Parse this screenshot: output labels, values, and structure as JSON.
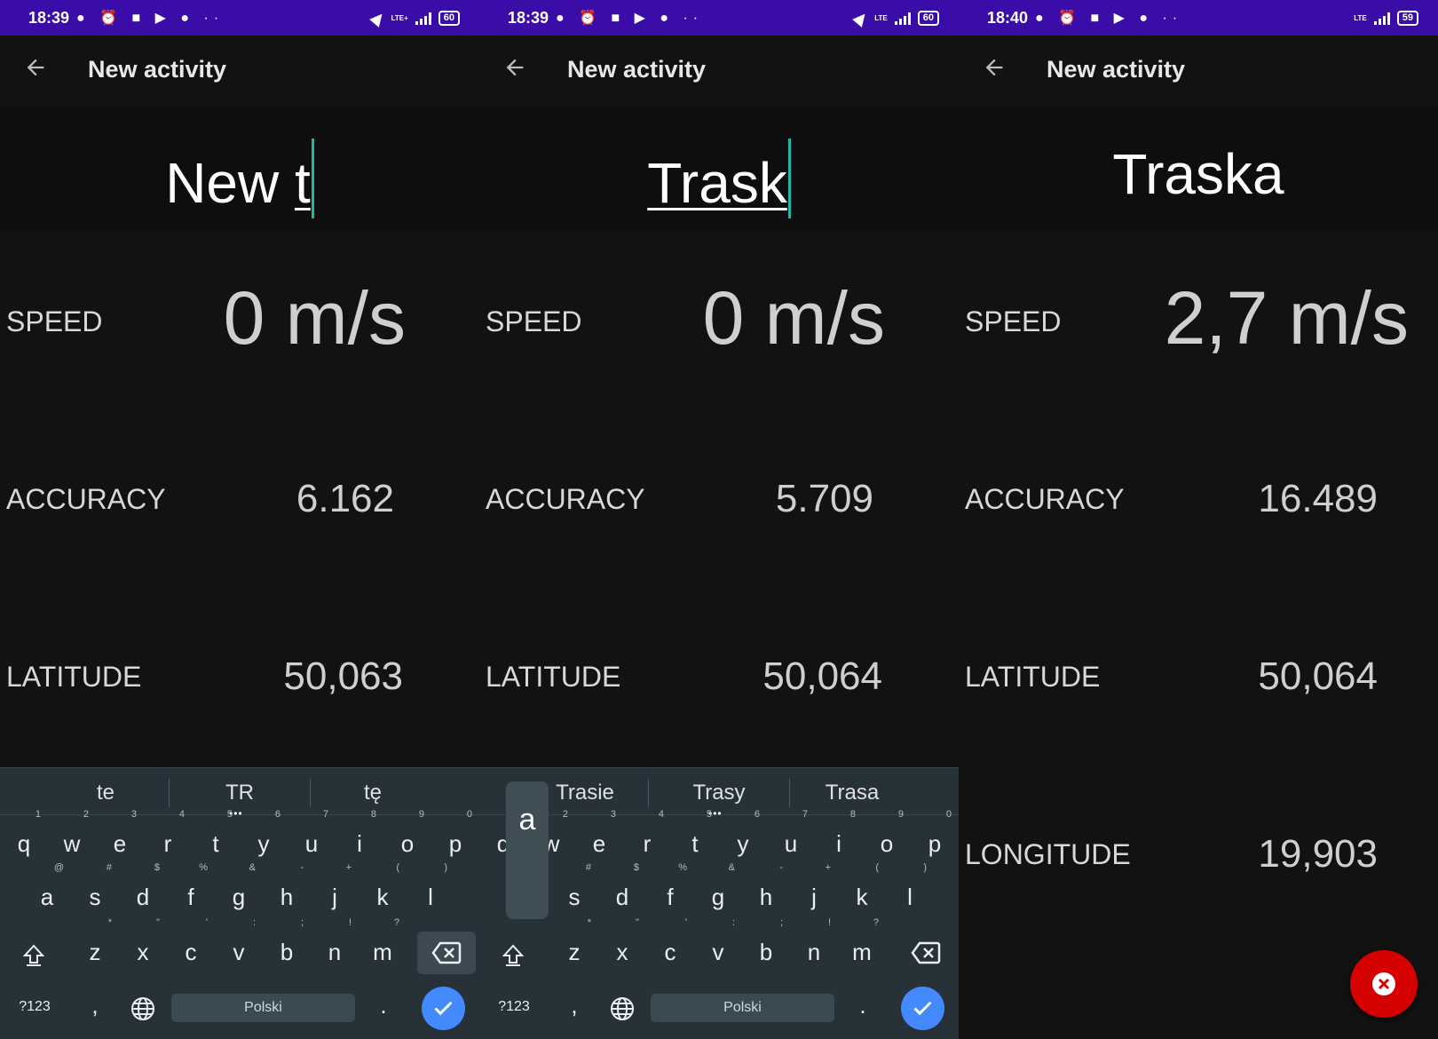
{
  "panels": [
    {
      "status": {
        "time": "18:39",
        "battery": "60",
        "net": "LTE+"
      },
      "title": "New activity",
      "name_value": "New ",
      "name_underlined": "t",
      "speed_label": "SPEED",
      "speed_value": "0 m/s",
      "accuracy_label": "ACCURACY",
      "accuracy_value": "6.162",
      "latitude_label": "LATITUDE",
      "latitude_value": "50,063",
      "suggestions": [
        "te",
        "TR",
        "tę"
      ]
    },
    {
      "status": {
        "time": "18:39",
        "battery": "60",
        "net": "LTE"
      },
      "title": "New activity",
      "name_value": "",
      "name_underlined": "Trask",
      "speed_label": "SPEED",
      "speed_value": "0 m/s",
      "accuracy_label": "ACCURACY",
      "accuracy_value": "5.709",
      "latitude_label": "LATITUDE",
      "latitude_value": "50,064",
      "suggestions": [
        "Trasie",
        "Trasy",
        "Trasa"
      ],
      "key_popup": "a"
    },
    {
      "status": {
        "time": "18:40",
        "battery": "59",
        "net": "LTE"
      },
      "title": "New activity",
      "name_value": "Traska",
      "speed_label": "SPEED",
      "speed_value": "2,7 m/s",
      "accuracy_label": "ACCURACY",
      "accuracy_value": "16.489",
      "latitude_label": "LATITUDE",
      "latitude_value": "50,064",
      "longitude_label": "LONGITUDE",
      "longitude_value": "19,903"
    }
  ],
  "keyboard": {
    "row1": [
      "q",
      "w",
      "e",
      "r",
      "t",
      "y",
      "u",
      "i",
      "o",
      "p"
    ],
    "row1_hints": [
      "1",
      "2",
      "3",
      "4",
      "5",
      "6",
      "7",
      "8",
      "9",
      "0"
    ],
    "row2": [
      "a",
      "s",
      "d",
      "f",
      "g",
      "h",
      "j",
      "k",
      "l"
    ],
    "row2_hints": [
      "@",
      "#",
      "$",
      "%",
      "&",
      "-",
      "+",
      "(",
      ")"
    ],
    "row3": [
      "z",
      "x",
      "c",
      "v",
      "b",
      "n",
      "m"
    ],
    "row3_hints": [
      "*",
      "\"",
      "'",
      ":",
      ";",
      "!",
      "?"
    ],
    "symbols_label": "?123",
    "comma": ",",
    "period": ".",
    "space_label": "Polski"
  },
  "colors": {
    "status_bar": "#3a0ca8",
    "caret": "#1fb7a5",
    "keyboard_bg": "#263238",
    "enter_key": "#448aff",
    "fab": "#d50000"
  },
  "icons": {
    "back": "arrow-left-icon",
    "globe": "globe-icon",
    "shift": "shift-icon",
    "backspace": "backspace-icon",
    "enter": "check-icon",
    "fab": "close-icon"
  }
}
